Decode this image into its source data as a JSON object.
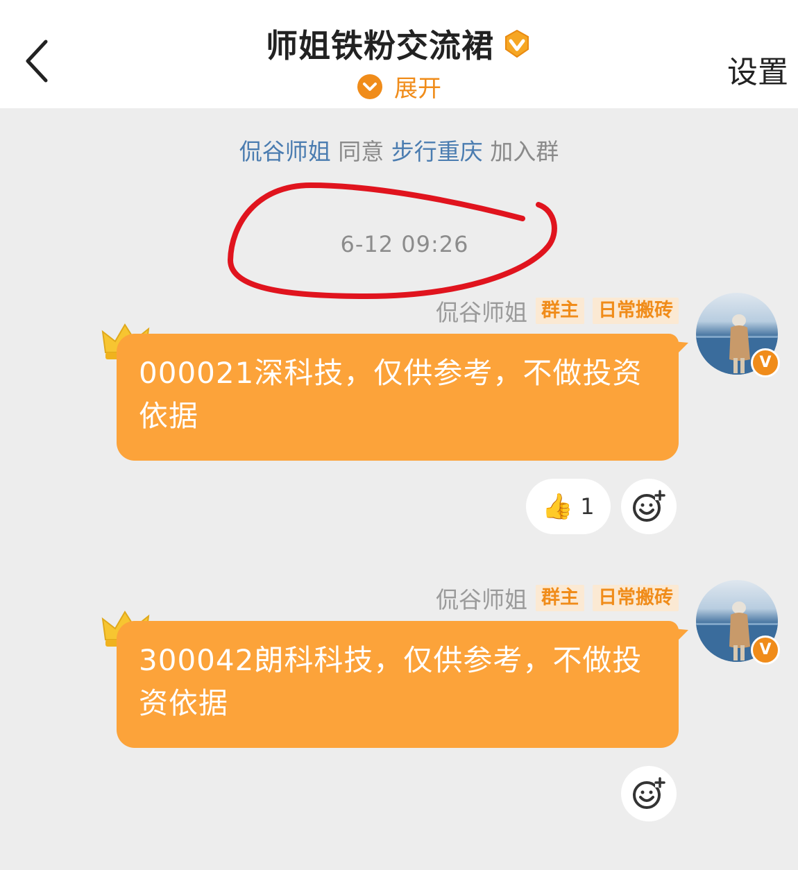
{
  "header": {
    "title": "师姐铁粉交流裙",
    "expand_label": "展开",
    "settings_label": "设置"
  },
  "system_message": {
    "actor": "侃谷师姐",
    "verb": "同意",
    "target": "步行重庆",
    "action": "加入群"
  },
  "timestamp": "6-12 09:26",
  "messages": [
    {
      "sender": "侃谷师姐",
      "tags": [
        "群主",
        "日常搬砖"
      ],
      "text": "000021深科技，仅供参考，不做投资依据",
      "reactions": [
        {
          "emoji": "👍",
          "count": "1"
        }
      ]
    },
    {
      "sender": "侃谷师姐",
      "tags": [
        "群主",
        "日常搬砖"
      ],
      "text": "300042朗科科技，仅供参考，不做投资依据",
      "reactions": []
    }
  ],
  "colors": {
    "accent": "#f08c1a",
    "bubble": "#fca33a",
    "link": "#4a7cb0",
    "annotation": "#e0141e"
  }
}
